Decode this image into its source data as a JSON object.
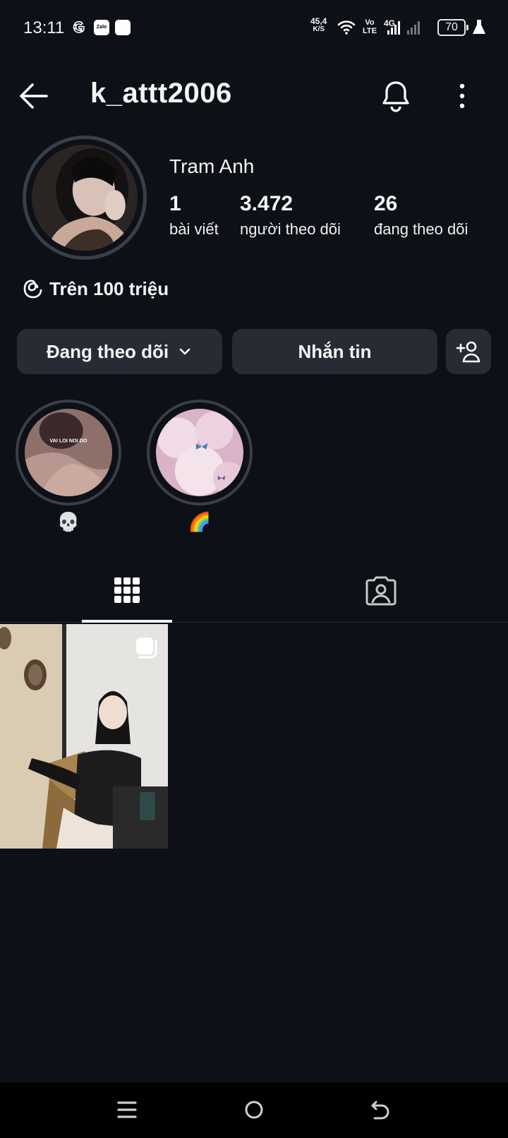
{
  "status_bar": {
    "time": "13:11",
    "net_speed_value": "45,4",
    "net_speed_unit": "K/S",
    "volte_top": "Vo",
    "volte_bottom": "LTE",
    "network_type": "4G",
    "battery": "70",
    "notification_icons": [
      "google-icon",
      "zalo-icon",
      "app-icon"
    ]
  },
  "header": {
    "username": "k_attt2006"
  },
  "profile": {
    "display_name": "Tram Anh",
    "stats": [
      {
        "value": "1",
        "label": "bài viết"
      },
      {
        "value": "3.472",
        "label": "người theo dõi"
      },
      {
        "value": "26",
        "label": "đang theo dõi"
      }
    ],
    "threads_badge": "Trên 100 triệu"
  },
  "actions": {
    "following_label": "Đang theo dõi",
    "message_label": "Nhắn tin"
  },
  "highlights": [
    {
      "label": "💀",
      "cover_text": "VAI LOI NOI DO"
    },
    {
      "label": "🌈",
      "cover_text": ""
    }
  ],
  "tabs": [
    {
      "name": "posts-grid",
      "icon": "grid-icon",
      "active": true
    },
    {
      "name": "tagged",
      "icon": "tagged-person-icon",
      "active": false
    }
  ],
  "colors": {
    "background": "#0d1017",
    "button_bg": "#272b33",
    "ring": "#3a3f47",
    "text": "#f5f5f5"
  }
}
